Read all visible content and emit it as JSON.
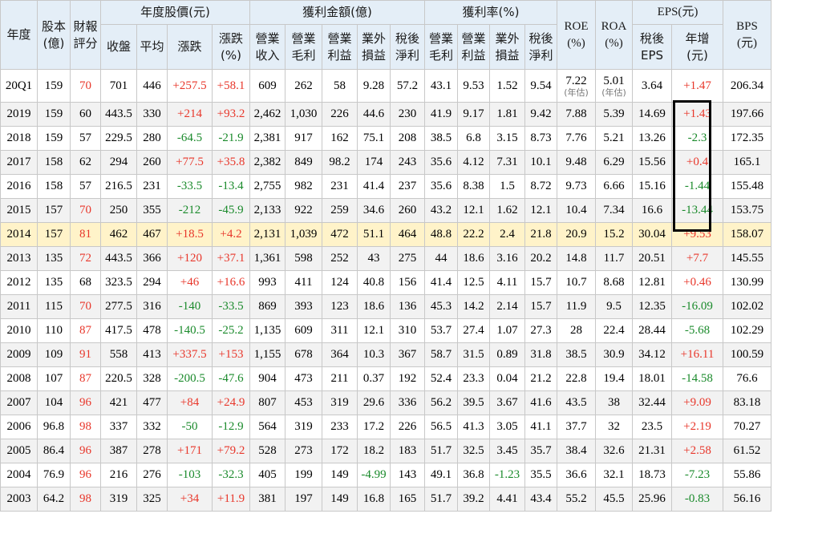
{
  "headers": {
    "year": "年度",
    "capital": "股本(億)",
    "rating": "財報評分",
    "price_group": "年度股價(元)",
    "price": [
      "收盤",
      "平均",
      "漲跌",
      "漲跌(%)"
    ],
    "profit_amount_group": "獲利金額(億)",
    "profit_amount": [
      "營業收入",
      "營業毛利",
      "營業利益",
      "業外損益",
      "稅後淨利"
    ],
    "profit_rate_group": "獲利率(%)",
    "profit_rate": [
      "營業毛利",
      "營業利益",
      "業外損益",
      "稅後淨利"
    ],
    "roe": "ROE(%)",
    "roa": "ROA(%)",
    "eps_group": "EPS(元)",
    "eps": [
      "稅後EPS",
      "年增(元)"
    ],
    "bps": "BPS(元)"
  },
  "roe_est_note": "(年估)",
  "roa_est_note": "(年估)",
  "colors": {
    "header_bg": "#e4eef7",
    "highlight_bg": "#fff3c9",
    "red": "#e8372b",
    "green": "#1a8a2b"
  },
  "rows": [
    {
      "year": "20Q1",
      "cap": "159",
      "rating": "70",
      "rc": "red",
      "close": "701",
      "avg": "446",
      "chg": "+257.5",
      "chgp": "+58.1",
      "cc": "red",
      "rev": "609",
      "gp": "262",
      "op": "58",
      "nonop": "9.28",
      "ni": "57.2",
      "gm": "43.1",
      "om": "9.53",
      "nm_non": "1.52",
      "nm": "9.54",
      "roe": "7.22",
      "roa": "5.01",
      "eps": "3.64",
      "epsg": "+1.47",
      "ec": "red",
      "bps": "206.34"
    },
    {
      "year": "2019",
      "cap": "159",
      "rating": "60",
      "rc": "",
      "close": "443.5",
      "avg": "330",
      "chg": "+214",
      "chgp": "+93.2",
      "cc": "red",
      "rev": "2,462",
      "gp": "1,030",
      "op": "226",
      "nonop": "44.6",
      "ni": "230",
      "gm": "41.9",
      "om": "9.17",
      "nm_non": "1.81",
      "nm": "9.42",
      "roe": "7.88",
      "roa": "5.39",
      "eps": "14.69",
      "epsg": "+1.43",
      "ec": "red",
      "bps": "197.66"
    },
    {
      "year": "2018",
      "cap": "159",
      "rating": "57",
      "rc": "",
      "close": "229.5",
      "avg": "280",
      "chg": "-64.5",
      "chgp": "-21.9",
      "cc": "green",
      "rev": "2,381",
      "gp": "917",
      "op": "162",
      "nonop": "75.1",
      "ni": "208",
      "gm": "38.5",
      "om": "6.8",
      "nm_non": "3.15",
      "nm": "8.73",
      "roe": "7.76",
      "roa": "5.21",
      "eps": "13.26",
      "epsg": "-2.3",
      "ec": "green",
      "bps": "172.35"
    },
    {
      "year": "2017",
      "cap": "158",
      "rating": "62",
      "rc": "",
      "close": "294",
      "avg": "260",
      "chg": "+77.5",
      "chgp": "+35.8",
      "cc": "red",
      "rev": "2,382",
      "gp": "849",
      "op": "98.2",
      "nonop": "174",
      "ni": "243",
      "gm": "35.6",
      "om": "4.12",
      "nm_non": "7.31",
      "nm": "10.1",
      "roe": "9.48",
      "roa": "6.29",
      "eps": "15.56",
      "epsg": "+0.4",
      "ec": "red",
      "bps": "165.1"
    },
    {
      "year": "2016",
      "cap": "158",
      "rating": "57",
      "rc": "",
      "close": "216.5",
      "avg": "231",
      "chg": "-33.5",
      "chgp": "-13.4",
      "cc": "green",
      "rev": "2,755",
      "gp": "982",
      "op": "231",
      "nonop": "41.4",
      "ni": "237",
      "gm": "35.6",
      "om": "8.38",
      "nm_non": "1.5",
      "nm": "8.72",
      "roe": "9.73",
      "roa": "6.66",
      "eps": "15.16",
      "epsg": "-1.44",
      "ec": "green",
      "bps": "155.48"
    },
    {
      "year": "2015",
      "cap": "157",
      "rating": "70",
      "rc": "red",
      "close": "250",
      "avg": "355",
      "chg": "-212",
      "chgp": "-45.9",
      "cc": "green",
      "rev": "2,133",
      "gp": "922",
      "op": "259",
      "nonop": "34.6",
      "ni": "260",
      "gm": "43.2",
      "om": "12.1",
      "nm_non": "1.62",
      "nm": "12.1",
      "roe": "10.4",
      "roa": "7.34",
      "eps": "16.6",
      "epsg": "-13.44",
      "ec": "green",
      "bps": "153.75"
    },
    {
      "year": "2014",
      "cap": "157",
      "rating": "81",
      "rc": "red",
      "close": "462",
      "avg": "467",
      "chg": "+18.5",
      "chgp": "+4.2",
      "cc": "red",
      "rev": "2,131",
      "gp": "1,039",
      "op": "472",
      "nonop": "51.1",
      "ni": "464",
      "gm": "48.8",
      "om": "22.2",
      "nm_non": "2.4",
      "nm": "21.8",
      "roe": "20.9",
      "roa": "15.2",
      "eps": "30.04",
      "epsg": "+9.53",
      "ec": "red",
      "bps": "158.07",
      "hl": true
    },
    {
      "year": "2013",
      "cap": "135",
      "rating": "72",
      "rc": "red",
      "close": "443.5",
      "avg": "366",
      "chg": "+120",
      "chgp": "+37.1",
      "cc": "red",
      "rev": "1,361",
      "gp": "598",
      "op": "252",
      "nonop": "43",
      "ni": "275",
      "gm": "44",
      "om": "18.6",
      "nm_non": "3.16",
      "nm": "20.2",
      "roe": "14.8",
      "roa": "11.7",
      "eps": "20.51",
      "epsg": "+7.7",
      "ec": "red",
      "bps": "145.55"
    },
    {
      "year": "2012",
      "cap": "135",
      "rating": "68",
      "rc": "",
      "close": "323.5",
      "avg": "294",
      "chg": "+46",
      "chgp": "+16.6",
      "cc": "red",
      "rev": "993",
      "gp": "411",
      "op": "124",
      "nonop": "40.8",
      "ni": "156",
      "gm": "41.4",
      "om": "12.5",
      "nm_non": "4.11",
      "nm": "15.7",
      "roe": "10.7",
      "roa": "8.68",
      "eps": "12.81",
      "epsg": "+0.46",
      "ec": "red",
      "bps": "130.99"
    },
    {
      "year": "2011",
      "cap": "115",
      "rating": "70",
      "rc": "red",
      "close": "277.5",
      "avg": "316",
      "chg": "-140",
      "chgp": "-33.5",
      "cc": "green",
      "rev": "869",
      "gp": "393",
      "op": "123",
      "nonop": "18.6",
      "ni": "136",
      "gm": "45.3",
      "om": "14.2",
      "nm_non": "2.14",
      "nm": "15.7",
      "roe": "11.9",
      "roa": "9.5",
      "eps": "12.35",
      "epsg": "-16.09",
      "ec": "green",
      "bps": "102.02"
    },
    {
      "year": "2010",
      "cap": "110",
      "rating": "87",
      "rc": "red",
      "close": "417.5",
      "avg": "478",
      "chg": "-140.5",
      "chgp": "-25.2",
      "cc": "green",
      "rev": "1,135",
      "gp": "609",
      "op": "311",
      "nonop": "12.1",
      "ni": "310",
      "gm": "53.7",
      "om": "27.4",
      "nm_non": "1.07",
      "nm": "27.3",
      "roe": "28",
      "roa": "22.4",
      "eps": "28.44",
      "epsg": "-5.68",
      "ec": "green",
      "bps": "102.29"
    },
    {
      "year": "2009",
      "cap": "109",
      "rating": "91",
      "rc": "red",
      "close": "558",
      "avg": "413",
      "chg": "+337.5",
      "chgp": "+153",
      "cc": "red",
      "rev": "1,155",
      "gp": "678",
      "op": "364",
      "nonop": "10.3",
      "ni": "367",
      "gm": "58.7",
      "om": "31.5",
      "nm_non": "0.89",
      "nm": "31.8",
      "roe": "38.5",
      "roa": "30.9",
      "eps": "34.12",
      "epsg": "+16.11",
      "ec": "red",
      "bps": "100.59"
    },
    {
      "year": "2008",
      "cap": "107",
      "rating": "87",
      "rc": "red",
      "close": "220.5",
      "avg": "328",
      "chg": "-200.5",
      "chgp": "-47.6",
      "cc": "green",
      "rev": "904",
      "gp": "473",
      "op": "211",
      "nonop": "0.37",
      "ni": "192",
      "gm": "52.4",
      "om": "23.3",
      "nm_non": "0.04",
      "nm": "21.2",
      "roe": "22.8",
      "roa": "19.4",
      "eps": "18.01",
      "epsg": "-14.58",
      "ec": "green",
      "bps": "76.6"
    },
    {
      "year": "2007",
      "cap": "104",
      "rating": "96",
      "rc": "red",
      "close": "421",
      "avg": "477",
      "chg": "+84",
      "chgp": "+24.9",
      "cc": "red",
      "rev": "807",
      "gp": "453",
      "op": "319",
      "nonop": "29.6",
      "ni": "336",
      "gm": "56.2",
      "om": "39.5",
      "nm_non": "3.67",
      "nm": "41.6",
      "roe": "43.5",
      "roa": "38",
      "eps": "32.44",
      "epsg": "+9.09",
      "ec": "red",
      "bps": "83.18"
    },
    {
      "year": "2006",
      "cap": "96.8",
      "rating": "98",
      "rc": "red",
      "close": "337",
      "avg": "332",
      "chg": "-50",
      "chgp": "-12.9",
      "cc": "green",
      "rev": "564",
      "gp": "319",
      "op": "233",
      "nonop": "17.2",
      "ni": "226",
      "gm": "56.5",
      "om": "41.3",
      "nm_non": "3.05",
      "nm": "41.1",
      "roe": "37.7",
      "roa": "32",
      "eps": "23.5",
      "epsg": "+2.19",
      "ec": "red",
      "bps": "70.27"
    },
    {
      "year": "2005",
      "cap": "86.4",
      "rating": "96",
      "rc": "red",
      "close": "387",
      "avg": "278",
      "chg": "+171",
      "chgp": "+79.2",
      "cc": "red",
      "rev": "528",
      "gp": "273",
      "op": "172",
      "nonop": "18.2",
      "ni": "183",
      "gm": "51.7",
      "om": "32.5",
      "nm_non": "3.45",
      "nm": "35.7",
      "roe": "38.4",
      "roa": "32.6",
      "eps": "21.31",
      "epsg": "+2.58",
      "ec": "red",
      "bps": "61.52"
    },
    {
      "year": "2004",
      "cap": "76.9",
      "rating": "96",
      "rc": "red",
      "close": "216",
      "avg": "276",
      "chg": "-103",
      "chgp": "-32.3",
      "cc": "green",
      "rev": "405",
      "gp": "199",
      "op": "149",
      "nonop": "-4.99",
      "nc": "green",
      "ni": "143",
      "gm": "49.1",
      "om": "36.8",
      "nm_non": "-1.23",
      "nnc": "green",
      "nm": "35.5",
      "roe": "36.6",
      "roa": "32.1",
      "eps": "18.73",
      "epsg": "-7.23",
      "ec": "green",
      "bps": "55.86"
    },
    {
      "year": "2003",
      "cap": "64.2",
      "rating": "98",
      "rc": "red",
      "close": "319",
      "avg": "325",
      "chg": "+34",
      "chgp": "+11.9",
      "cc": "red",
      "rev": "381",
      "gp": "197",
      "op": "149",
      "nonop": "16.8",
      "ni": "165",
      "gm": "51.7",
      "om": "39.2",
      "nm_non": "4.41",
      "nm": "43.4",
      "roe": "55.2",
      "roa": "45.5",
      "eps": "25.96",
      "epsg": "-0.83",
      "ec": "green",
      "bps": "56.16"
    }
  ]
}
